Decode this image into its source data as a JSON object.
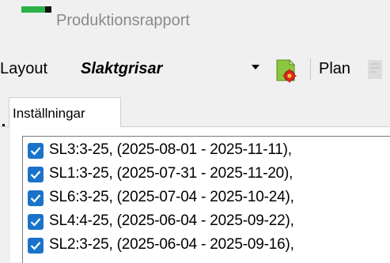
{
  "window": {
    "title": "Produktionsrapport"
  },
  "toolbar": {
    "layout_label": "Layout",
    "layout_value": "Slaktgrisar",
    "plan_label": "Plan"
  },
  "tabs": [
    {
      "label": "Inställningar"
    }
  ],
  "list": {
    "items": [
      {
        "label": "SL3:3-25, (2025-08-01 - 2025-11-11),",
        "checked": true
      },
      {
        "label": "SL1:3-25, (2025-07-31 - 2025-11-20),",
        "checked": true
      },
      {
        "label": "SL6:3-25, (2025-07-04 - 2025-10-24),",
        "checked": true
      },
      {
        "label": "SL4:4-25, (2025-06-04 - 2025-09-22),",
        "checked": true
      },
      {
        "label": "SL2:3-25, (2025-06-04 - 2025-09-16),",
        "checked": true
      }
    ]
  },
  "colors": {
    "accent": "#1a73c9",
    "brand_green": "#2bb34a"
  }
}
